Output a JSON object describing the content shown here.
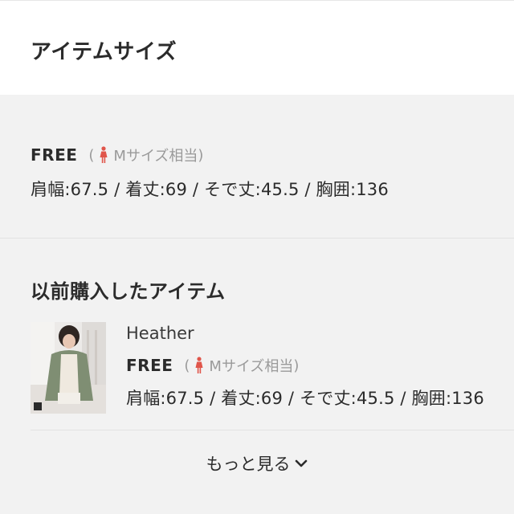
{
  "header": {
    "title": "アイテムサイズ"
  },
  "size": {
    "name": "FREE",
    "paren_open": "(",
    "equivalent": "Mサイズ相当",
    "paren_close": ")",
    "measurements": "肩幅:67.5 / 着丈:69 / そで丈:45.5 / 胸囲:136"
  },
  "previous": {
    "title": "以前購入したアイテム",
    "item": {
      "brand": "Heather",
      "size_name": "FREE",
      "paren_open": "(",
      "equivalent": "Mサイズ相当",
      "paren_close": ")",
      "measurements": "肩幅:67.5 / 着丈:69 / そで丈:45.5 / 胸囲:136"
    }
  },
  "more": {
    "label": "もっと見る"
  },
  "colors": {
    "accent": "#e0554a",
    "muted": "#9a9a9a"
  }
}
